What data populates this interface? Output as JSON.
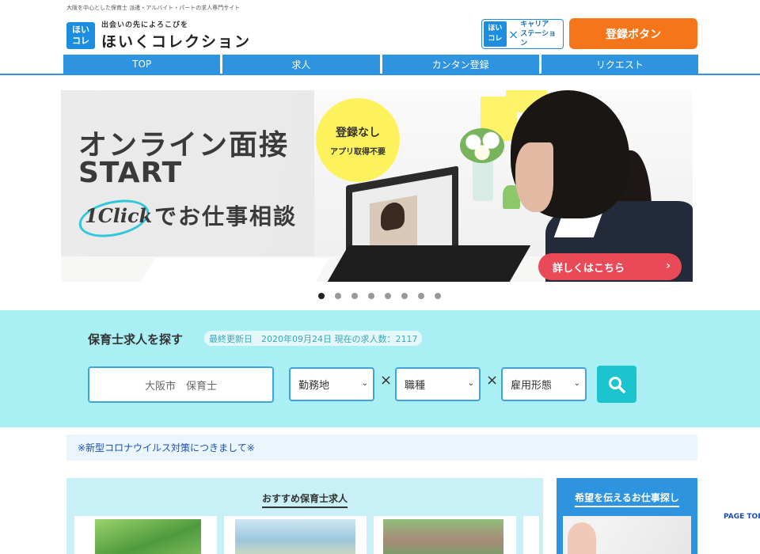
{
  "header": {
    "tagline": "大阪を中心とした保育士 派遣・アルバイト・パートの求人専門サイト",
    "logo_badge_top": "ほい",
    "logo_badge_bottom": "コレ",
    "logo_catch": "出会いの先によろこびを",
    "logo_name": "ほいくコレクション",
    "partner_badge_top": "ほい",
    "partner_badge_bottom": "コレ",
    "partner_x": "×",
    "partner_line1": "キャリア",
    "partner_line2": "ステーション",
    "register_label": "登録ボタン"
  },
  "nav": {
    "items": [
      {
        "label": "TOP"
      },
      {
        "label": "求人"
      },
      {
        "label": "カンタン登録"
      },
      {
        "label": "リクエスト"
      }
    ]
  },
  "banner": {
    "headline1": "オンライン面接",
    "headline2": "START",
    "click_text": "1Click",
    "headline3": "でお仕事相談",
    "bubble_line1": "登録なし",
    "bubble_line2": "アプリ取得不要",
    "cta_label": "詳しくはこちら",
    "cta_arrow": "›",
    "slide_count": 8,
    "active_slide": 1
  },
  "search": {
    "title": "保育士求人を探す",
    "info": "最終更新日　2020年09月24日 現在の求人数：2117",
    "keyword_placeholder": "大阪市　保育士",
    "select_area": "勤務地",
    "select_job": "職種",
    "select_employment": "雇用形態",
    "times": "×",
    "caret": "⌄"
  },
  "notice": {
    "text": "※新型コロナウイルス対策につきまして※"
  },
  "recommend": {
    "title": "おすすめ保育士求人"
  },
  "sidebar": {
    "title": "希望を伝えるお仕事探し"
  },
  "pagetop": {
    "label": "PAGE TOP"
  },
  "colors": {
    "primary_blue": "#2f94e0",
    "register_orange": "#f5751a",
    "search_bg": "#a9eff3",
    "search_button": "#1cc4cf",
    "cta_red": "#ea4a58",
    "bubble_yellow": "#fdf25e"
  }
}
